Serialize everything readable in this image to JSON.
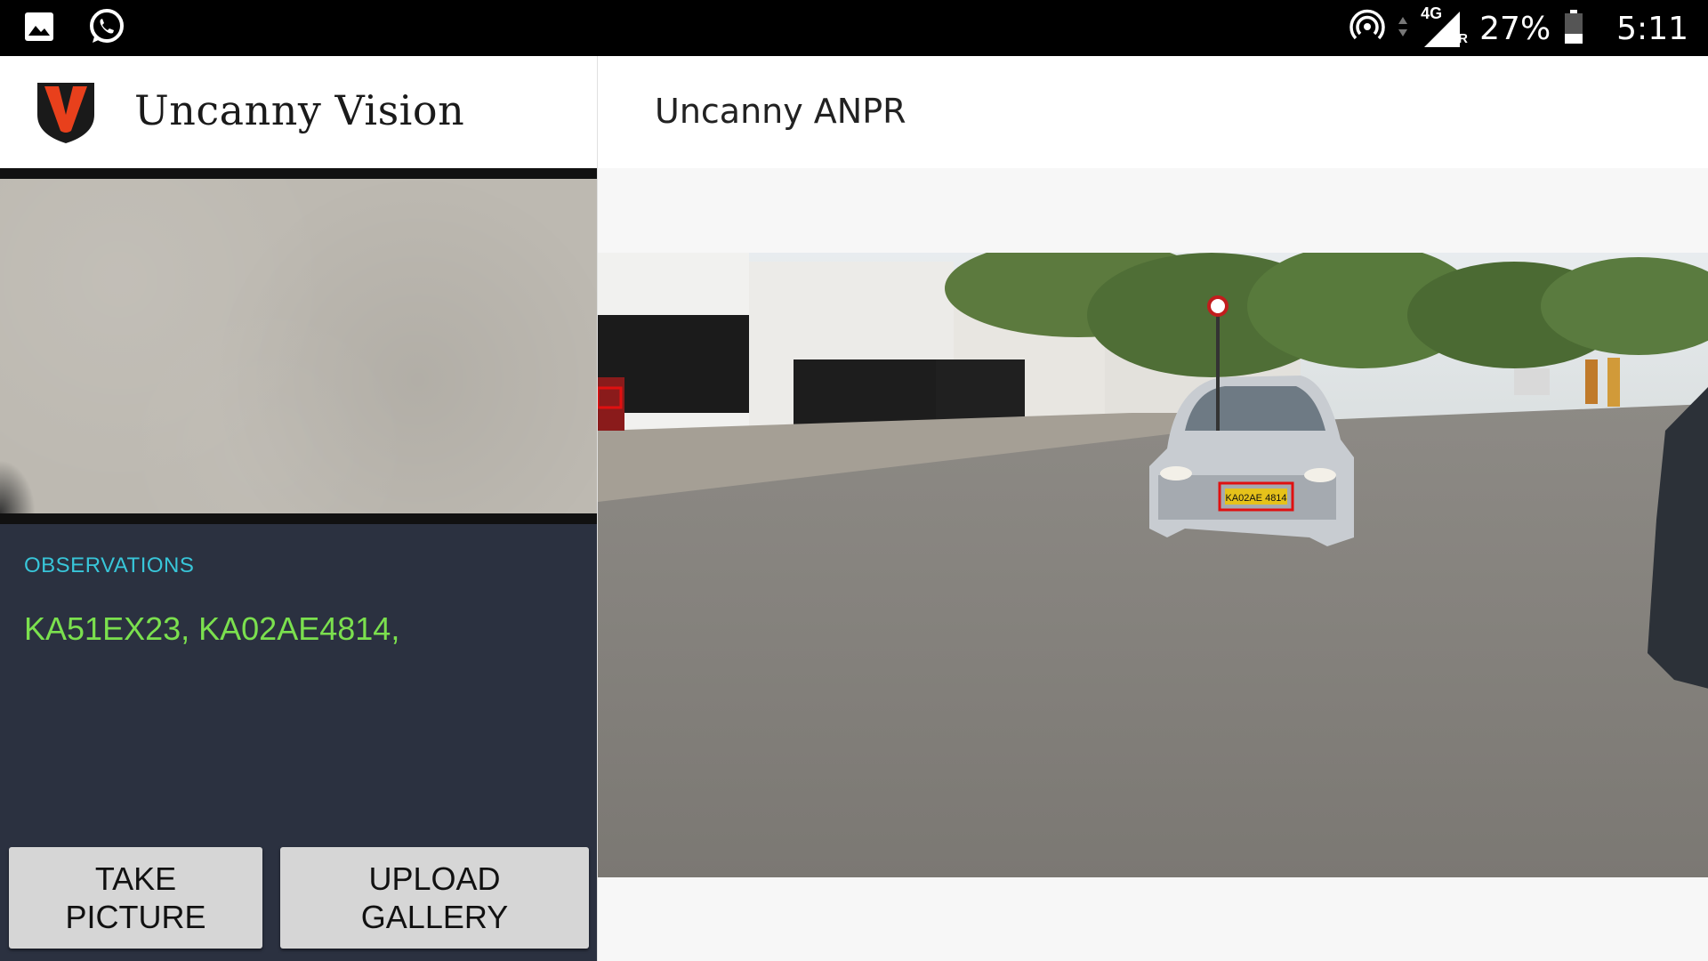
{
  "status_bar": {
    "icons_left": [
      "gallery-icon",
      "whatsapp-icon"
    ],
    "icons_right": [
      "hotspot-icon",
      "data-arrows-icon",
      "signal-4g-icon",
      "battery-icon"
    ],
    "network": "4G",
    "roaming": "R",
    "battery": "27%",
    "time": "5:11"
  },
  "brand": {
    "name": "Uncanny Vision",
    "logo_icon": "uncanny-vision-logo-icon",
    "logo_colors": {
      "primary": "#e8401c",
      "dark": "#1a1a1a"
    }
  },
  "observations": {
    "label": "OBSERVATIONS",
    "value": "KA51EX23, KA02AE4814,"
  },
  "buttons": {
    "take_line1": "TAKE",
    "take_line2": "PICTURE",
    "upload_line1": "UPLOAD",
    "upload_line2": "GALLERY"
  },
  "result": {
    "title": "Uncanny ANPR",
    "plate_text": "KA02AE 4814",
    "detection_color": "#e01010"
  },
  "colors": {
    "obs_label": "#38c6d9",
    "obs_value": "#7be04e",
    "panel_bg": "#2b3140"
  }
}
